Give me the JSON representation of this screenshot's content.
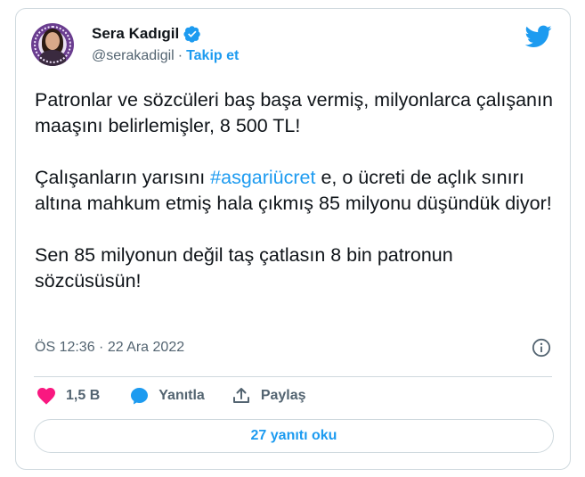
{
  "author": {
    "name": "Sera Kadıgil",
    "handle": "@serakadigil",
    "separator": "·",
    "follow_label": "Takip et"
  },
  "tweet": {
    "paragraphs": [
      {
        "text": "Patronlar ve sözcüleri baş başa vermiş, milyonlarca çalışanın maaşını belirlemişler, 8 500 TL!"
      },
      {
        "before": "Çalışanların yarısını ",
        "hashtag": "#asgariücret",
        "after": " e, o ücreti de açlık sınırı altına mahkum etmiş hala çıkmış 85 milyonu düşündük diyor!"
      },
      {
        "text": "Sen 85 milyonun değil taş çatlasın 8 bin patronun sözcüsüsün!"
      }
    ],
    "timestamp": "ÖS 12:36 · 22 Ara 2022"
  },
  "actions": {
    "like_count": "1,5 B",
    "reply_label": "Yanıtla",
    "share_label": "Paylaş"
  },
  "read_replies_label": "27 yanıtı oku",
  "colors": {
    "accent": "#1d9bf0",
    "like": "#f91880",
    "text": "#0f1419",
    "muted": "#536471",
    "border": "#cfd9de"
  },
  "icons": [
    "avatar",
    "verified-badge-icon",
    "twitter-bird-icon",
    "info-icon",
    "heart-icon",
    "reply-icon",
    "share-icon"
  ]
}
